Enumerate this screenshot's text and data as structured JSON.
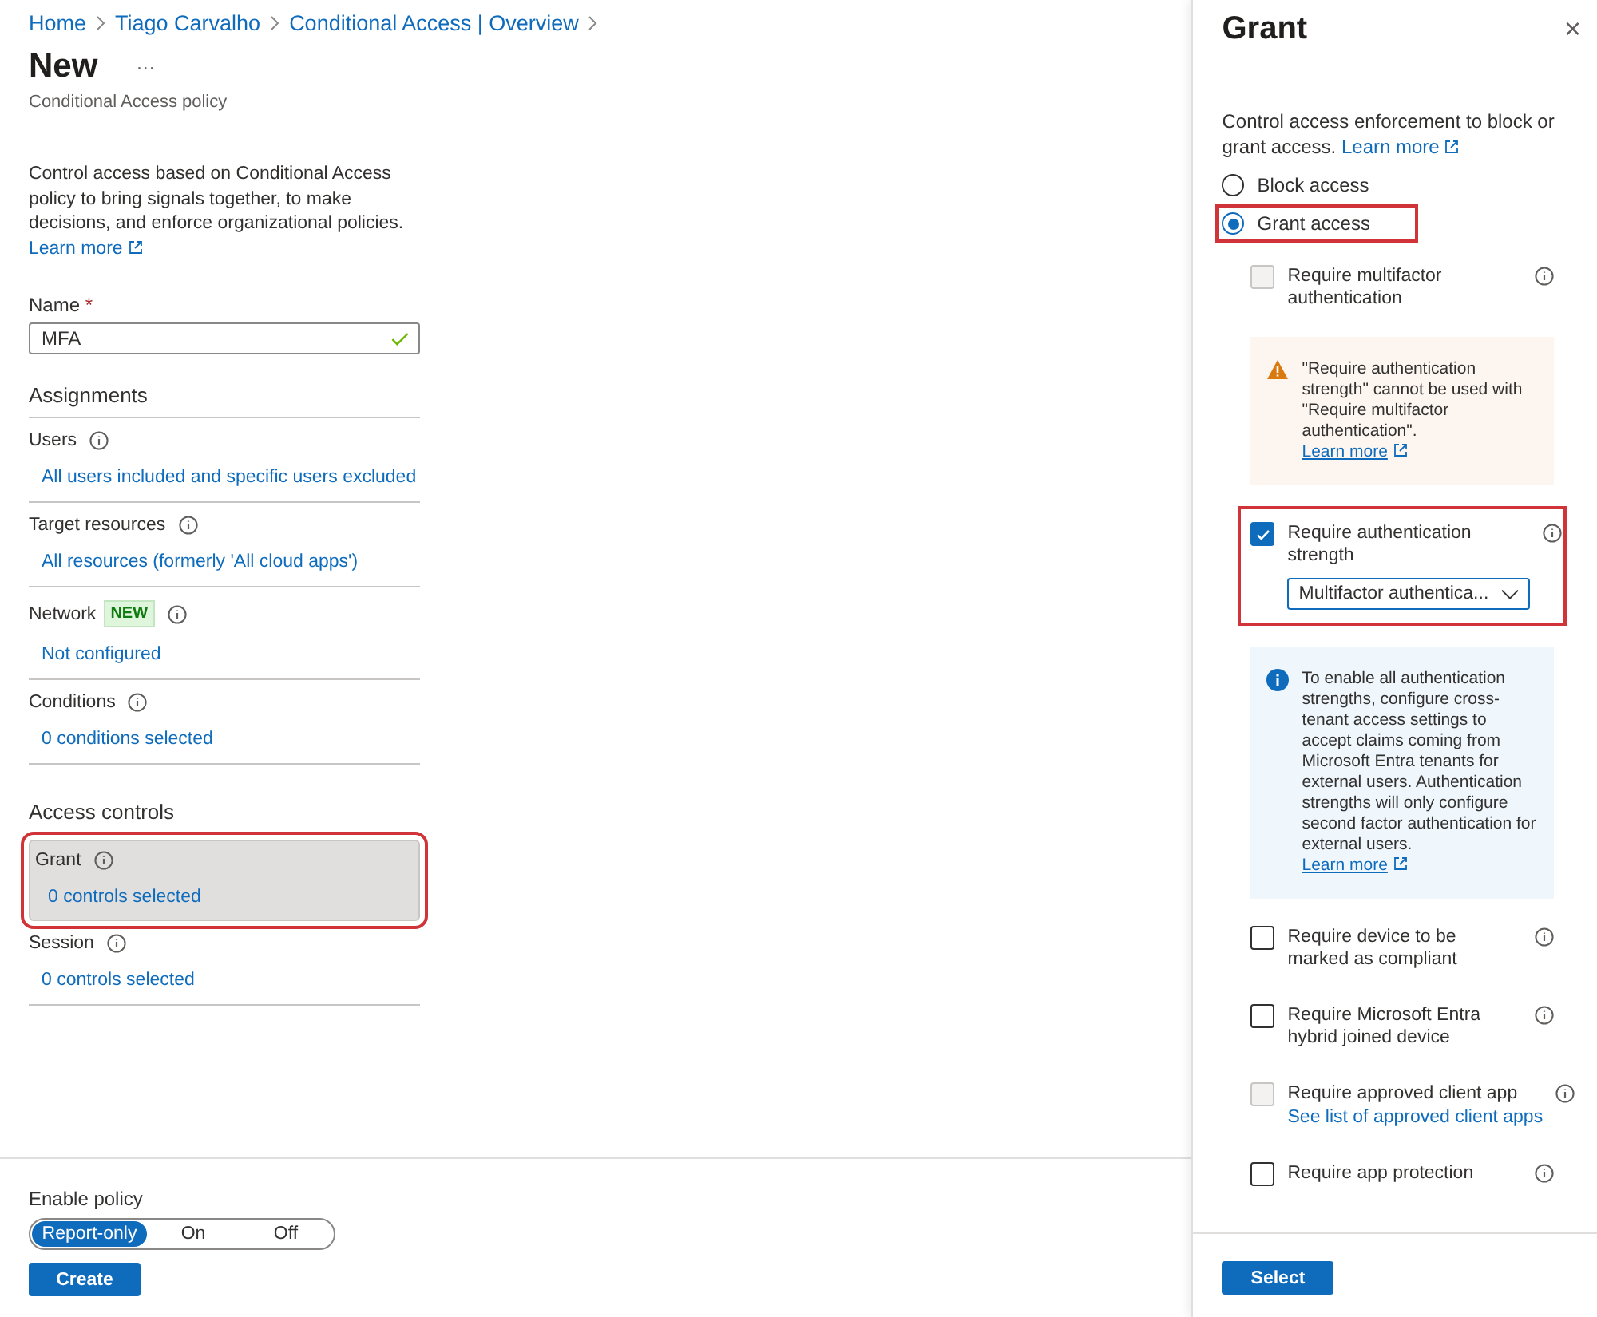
{
  "breadcrumb": [
    "Home",
    "Tiago Carvalho",
    "Conditional Access | Overview"
  ],
  "page": {
    "title": "New",
    "more": "···",
    "subtitle": "Conditional Access policy",
    "description": "Control access based on Conditional Access policy to bring signals together, to make decisions, and enforce organizational policies.",
    "learn_more": "Learn more"
  },
  "name_field": {
    "label": "Name",
    "required": "*",
    "value": "MFA",
    "valid": true
  },
  "groups": [
    {
      "heading": "Assignments",
      "items": [
        {
          "label": "Users",
          "value": "All users included and specific users excluded",
          "selected": false,
          "highlighted": false
        },
        {
          "label": "Target resources",
          "value": "All resources (formerly 'All cloud apps')",
          "selected": false,
          "highlighted": false
        },
        {
          "label": "Network",
          "badge": "NEW",
          "value": "Not configured",
          "selected": false,
          "highlighted": false
        },
        {
          "label": "Conditions",
          "value": "0 conditions selected",
          "selected": false,
          "highlighted": false
        }
      ]
    },
    {
      "heading": "Access controls",
      "items": [
        {
          "label": "Grant",
          "value": "0 controls selected",
          "selected": true,
          "highlighted": true
        },
        {
          "label": "Session",
          "value": "0 controls selected",
          "selected": false,
          "highlighted": false
        }
      ]
    }
  ],
  "enable_policy": {
    "label": "Enable policy",
    "options": [
      {
        "label": "Report-only",
        "selected": true
      },
      {
        "label": "On",
        "selected": false
      },
      {
        "label": "Off",
        "selected": false
      }
    ]
  },
  "create_button": "Create",
  "panel": {
    "title": "Grant",
    "close": "×",
    "intro": "Control access enforcement to block or grant access.",
    "learn_more": "Learn more",
    "radios": [
      {
        "label": "Block access",
        "selected": false,
        "highlighted": false
      },
      {
        "label": "Grant access",
        "selected": true,
        "highlighted": true
      }
    ],
    "options": [
      {
        "kind": "checkbox",
        "label": "Require multifactor authentication",
        "checked": false,
        "disabled": true,
        "highlighted": false
      },
      {
        "kind": "warning",
        "text": "\"Require authentication strength\" cannot be used with \"Require multifactor authentication\".",
        "link": "Learn more"
      },
      {
        "kind": "checkbox",
        "label": "Require authentication strength",
        "checked": true,
        "disabled": false,
        "highlighted": true,
        "dropdown": "Multifactor authentica..."
      },
      {
        "kind": "info",
        "text": "To enable all authentication strengths, configure cross-tenant access settings to accept claims coming from Microsoft Entra tenants for external users. Authentication strengths will only configure second factor authentication for external users.",
        "link": "Learn more"
      },
      {
        "kind": "checkbox",
        "label": "Require device to be marked as compliant",
        "checked": false,
        "disabled": false,
        "highlighted": false
      },
      {
        "kind": "checkbox",
        "label": "Require Microsoft Entra hybrid joined device",
        "checked": false,
        "disabled": false,
        "highlighted": false
      },
      {
        "kind": "checkbox",
        "label": "Require approved client app",
        "checked": false,
        "disabled": true,
        "highlighted": false,
        "link": "See list of approved client apps"
      },
      {
        "kind": "checkbox",
        "label": "Require app protection",
        "checked": false,
        "disabled": false,
        "highlighted": false
      }
    ],
    "select_button": "Select"
  }
}
